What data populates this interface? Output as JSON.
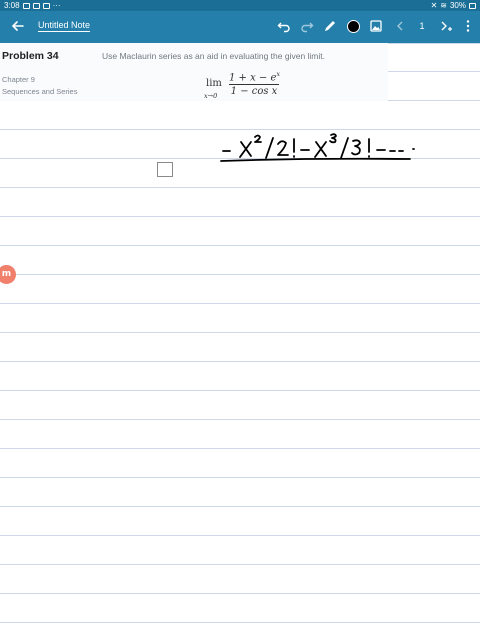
{
  "status_bar": {
    "time": "3:08",
    "more": "···",
    "battery": "30%"
  },
  "toolbar": {
    "title": "Untitled Note",
    "page_number": "1",
    "pen_color": "#000000",
    "accent": "#2480ab"
  },
  "problem": {
    "title": "Problem 34",
    "chapter": "Chapter 9",
    "section": "Sequences and Series",
    "instruction": "Use Maclaurin series as an aid in evaluating the given limit.",
    "limit_word": "lim",
    "limit_sub": "x→0",
    "numerator": "1 + x − e",
    "numerator_exp": "x",
    "denominator": "1 − cos x"
  },
  "handwriting": "- x²/2! - x³/3! - - - .",
  "float_button": "m"
}
